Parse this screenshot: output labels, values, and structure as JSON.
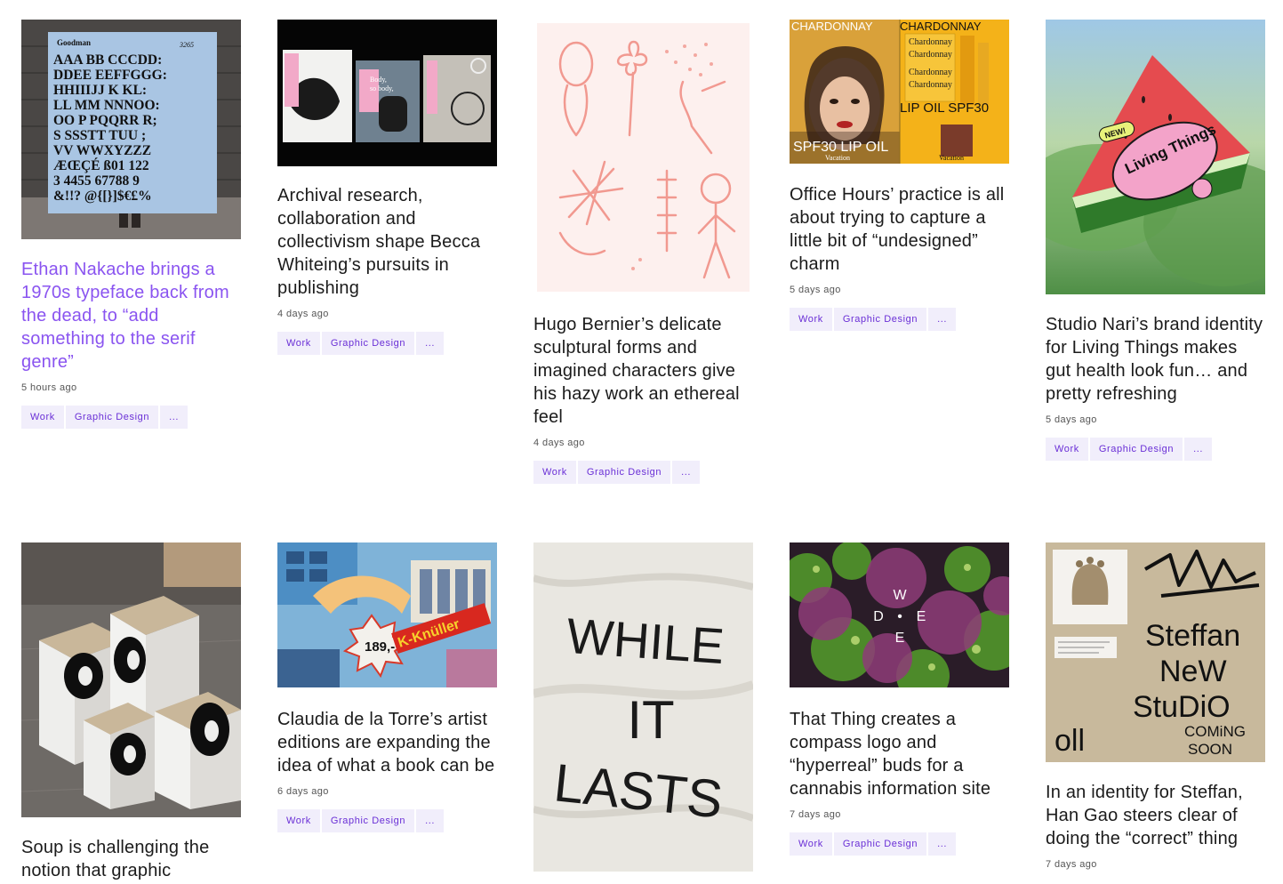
{
  "accent_color": "#8a54f0",
  "tag_color": "#6a2fd6",
  "cards": [
    {
      "title": "Ethan Nakache brings a 1970s typeface back from the dead, to “add something to the serif genre”",
      "time": "5 hours ago",
      "tags": [
        "Work",
        "Graphic Design",
        "..."
      ]
    },
    {
      "title": "Archival research, collaboration and collectivism shape Becca Whiteing’s pursuits in publishing",
      "time": "4 days ago",
      "tags": [
        "Work",
        "Graphic Design",
        "..."
      ]
    },
    {
      "title": "Hugo Bernier’s delicate sculptural forms and imagined characters give his hazy work an ethereal feel",
      "time": "4 days ago",
      "tags": [
        "Work",
        "Graphic Design",
        "..."
      ]
    },
    {
      "title": "Office Hours’ practice is all about trying to capture a little bit of “undesigned” charm",
      "time": "5 days ago",
      "tags": [
        "Work",
        "Graphic Design",
        "..."
      ]
    },
    {
      "title": "Studio Nari’s brand identity for Living Things makes gut health look fun… and pretty refreshing",
      "time": "5 days ago",
      "tags": [
        "Work",
        "Graphic Design",
        "..."
      ]
    },
    {
      "title": "Soup is challenging the notion that graphic",
      "time": "",
      "tags": []
    },
    {
      "title": "Claudia de la Torre’s artist editions are expanding the idea of what a book can be",
      "time": "6 days ago",
      "tags": [
        "Work",
        "Graphic Design",
        "..."
      ]
    },
    {
      "title": "",
      "time": "",
      "tags": []
    },
    {
      "title": "That Thing creates a compass logo and “hyperreal” buds for a cannabis information site",
      "time": "7 days ago",
      "tags": [
        "Work",
        "Graphic Design",
        "..."
      ]
    },
    {
      "title": "In an identity for Steffan, Han Gao steers clear of doing the “correct” thing",
      "time": "7 days ago",
      "tags": []
    }
  ],
  "image_text": {
    "goodman_brand": "Goodman",
    "goodman_code": "3265",
    "goodman_lines": [
      "AAA BB CCCDD:",
      "DDEE EEFFGGG:",
      "HHIIIJJ K KL:",
      "LL MM NNNOO:",
      "OO P PQQRR R;",
      "S SSSTT TUU ;",
      "VV WWXYZZZ",
      "ÆŒÇÉ ß01 122",
      "3 4455 67788 9",
      "&!!? @{[}]$€£%"
    ],
    "chardonnay": "CHARDONNAY",
    "lip_oil": "LIP OIL SPF30",
    "spf_oil": "SPF30 LIP OIL",
    "vacation": "Vacation",
    "living_things": "Living Things",
    "new_badge": "NEW!",
    "price": "189,-",
    "knuller": "K-Knüller",
    "while_it_lasts": [
      "WHILE",
      "IT",
      "LASTS"
    ],
    "wede": [
      "W",
      "D",
      "•",
      "E",
      "E"
    ],
    "steffan_words": [
      "Steffan",
      "NeW",
      "StuDiO",
      "COMiNG",
      "SOON"
    ],
    "oll": "oll"
  }
}
